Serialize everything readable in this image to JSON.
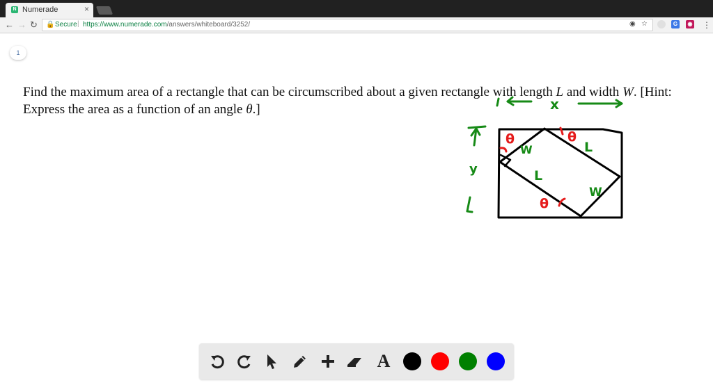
{
  "browser": {
    "tab": {
      "title": "Numerade",
      "favicon": "N",
      "close": "×"
    },
    "address": {
      "secure_label": "Secure",
      "separator": "|",
      "url_scheme": "https://",
      "url_host": "www.numerade.com",
      "url_path": "/answers/whiteboard/3252/"
    },
    "colors": {
      "tabstrip": "#212121",
      "secure": "#0b8043"
    }
  },
  "page": {
    "number": "1",
    "problem": {
      "part1": "Find the maximum area of a rectangle that can be circumscribed about a given rectangle with length ",
      "L": "L",
      "part2": " and width ",
      "W": "W",
      "part3": ". [Hint: Express the area as a function of an angle ",
      "theta": "θ",
      "part4": ".]"
    }
  },
  "sketch": {
    "labels": {
      "x_label": "x",
      "y_label": "y",
      "l_top": "L",
      "w_left": "W",
      "l_middle": "L",
      "w_right": "W",
      "theta_top_left": "θ",
      "theta_top_right": "θ",
      "theta_bottom": "θ"
    },
    "colors": {
      "black": "#000000",
      "red": "#e51c1c",
      "green": "#168a16"
    }
  },
  "draw_toolbar": {
    "tools": [
      "undo-icon",
      "redo-icon",
      "pointer-icon",
      "pencil-icon",
      "add-icon",
      "eraser-icon",
      "text-tool"
    ],
    "text_tool_label": "A",
    "color_swatches": [
      "#000000",
      "#ff0000",
      "#008000",
      "#0000ff"
    ]
  }
}
